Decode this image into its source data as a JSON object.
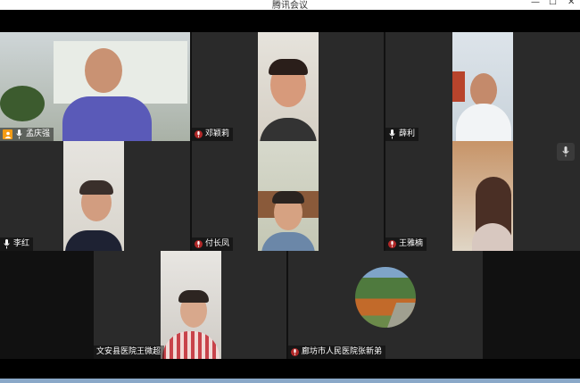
{
  "window": {
    "title": "腾讯会议",
    "minimize_glyph": "—",
    "maximize_glyph": "☐",
    "close_glyph": "✕"
  },
  "participants": [
    {
      "name": "孟庆强",
      "role": "host",
      "speaking": true
    },
    {
      "name": "邓颖莉"
    },
    {
      "name": "薛利"
    },
    {
      "name": "李红"
    },
    {
      "name": "付长凤"
    },
    {
      "name": "王雅楠"
    },
    {
      "name": "文安县医院王微超"
    },
    {
      "name": "廊坊市人民医院张新弟"
    }
  ],
  "colors": {
    "active_border": "#35c759",
    "host_badge": "#f39b14",
    "tile_background": "#2a2a2a"
  },
  "icons": {
    "mic": "microphone-icon",
    "host": "host-user-icon",
    "side_mic": "microphone-icon"
  }
}
